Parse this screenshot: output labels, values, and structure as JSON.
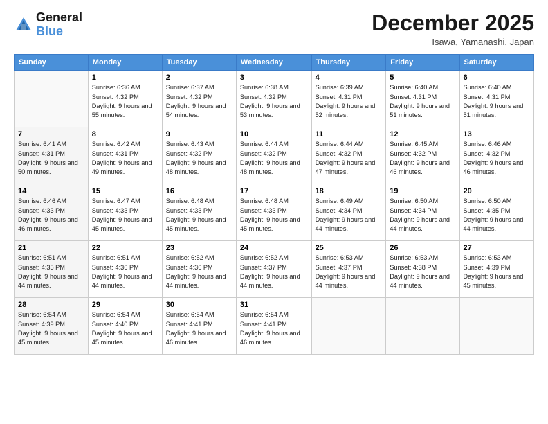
{
  "logo": {
    "line1": "General",
    "line2": "Blue"
  },
  "title": "December 2025",
  "location": "Isawa, Yamanashi, Japan",
  "days_header": [
    "Sunday",
    "Monday",
    "Tuesday",
    "Wednesday",
    "Thursday",
    "Friday",
    "Saturday"
  ],
  "weeks": [
    [
      {
        "day": "",
        "sunrise": "",
        "sunset": "",
        "daylight": ""
      },
      {
        "day": "1",
        "sunrise": "Sunrise: 6:36 AM",
        "sunset": "Sunset: 4:32 PM",
        "daylight": "Daylight: 9 hours and 55 minutes."
      },
      {
        "day": "2",
        "sunrise": "Sunrise: 6:37 AM",
        "sunset": "Sunset: 4:32 PM",
        "daylight": "Daylight: 9 hours and 54 minutes."
      },
      {
        "day": "3",
        "sunrise": "Sunrise: 6:38 AM",
        "sunset": "Sunset: 4:32 PM",
        "daylight": "Daylight: 9 hours and 53 minutes."
      },
      {
        "day": "4",
        "sunrise": "Sunrise: 6:39 AM",
        "sunset": "Sunset: 4:31 PM",
        "daylight": "Daylight: 9 hours and 52 minutes."
      },
      {
        "day": "5",
        "sunrise": "Sunrise: 6:40 AM",
        "sunset": "Sunset: 4:31 PM",
        "daylight": "Daylight: 9 hours and 51 minutes."
      },
      {
        "day": "6",
        "sunrise": "Sunrise: 6:40 AM",
        "sunset": "Sunset: 4:31 PM",
        "daylight": "Daylight: 9 hours and 51 minutes."
      }
    ],
    [
      {
        "day": "7",
        "sunrise": "Sunrise: 6:41 AM",
        "sunset": "Sunset: 4:31 PM",
        "daylight": "Daylight: 9 hours and 50 minutes."
      },
      {
        "day": "8",
        "sunrise": "Sunrise: 6:42 AM",
        "sunset": "Sunset: 4:31 PM",
        "daylight": "Daylight: 9 hours and 49 minutes."
      },
      {
        "day": "9",
        "sunrise": "Sunrise: 6:43 AM",
        "sunset": "Sunset: 4:32 PM",
        "daylight": "Daylight: 9 hours and 48 minutes."
      },
      {
        "day": "10",
        "sunrise": "Sunrise: 6:44 AM",
        "sunset": "Sunset: 4:32 PM",
        "daylight": "Daylight: 9 hours and 48 minutes."
      },
      {
        "day": "11",
        "sunrise": "Sunrise: 6:44 AM",
        "sunset": "Sunset: 4:32 PM",
        "daylight": "Daylight: 9 hours and 47 minutes."
      },
      {
        "day": "12",
        "sunrise": "Sunrise: 6:45 AM",
        "sunset": "Sunset: 4:32 PM",
        "daylight": "Daylight: 9 hours and 46 minutes."
      },
      {
        "day": "13",
        "sunrise": "Sunrise: 6:46 AM",
        "sunset": "Sunset: 4:32 PM",
        "daylight": "Daylight: 9 hours and 46 minutes."
      }
    ],
    [
      {
        "day": "14",
        "sunrise": "Sunrise: 6:46 AM",
        "sunset": "Sunset: 4:33 PM",
        "daylight": "Daylight: 9 hours and 46 minutes."
      },
      {
        "day": "15",
        "sunrise": "Sunrise: 6:47 AM",
        "sunset": "Sunset: 4:33 PM",
        "daylight": "Daylight: 9 hours and 45 minutes."
      },
      {
        "day": "16",
        "sunrise": "Sunrise: 6:48 AM",
        "sunset": "Sunset: 4:33 PM",
        "daylight": "Daylight: 9 hours and 45 minutes."
      },
      {
        "day": "17",
        "sunrise": "Sunrise: 6:48 AM",
        "sunset": "Sunset: 4:33 PM",
        "daylight": "Daylight: 9 hours and 45 minutes."
      },
      {
        "day": "18",
        "sunrise": "Sunrise: 6:49 AM",
        "sunset": "Sunset: 4:34 PM",
        "daylight": "Daylight: 9 hours and 44 minutes."
      },
      {
        "day": "19",
        "sunrise": "Sunrise: 6:50 AM",
        "sunset": "Sunset: 4:34 PM",
        "daylight": "Daylight: 9 hours and 44 minutes."
      },
      {
        "day": "20",
        "sunrise": "Sunrise: 6:50 AM",
        "sunset": "Sunset: 4:35 PM",
        "daylight": "Daylight: 9 hours and 44 minutes."
      }
    ],
    [
      {
        "day": "21",
        "sunrise": "Sunrise: 6:51 AM",
        "sunset": "Sunset: 4:35 PM",
        "daylight": "Daylight: 9 hours and 44 minutes."
      },
      {
        "day": "22",
        "sunrise": "Sunrise: 6:51 AM",
        "sunset": "Sunset: 4:36 PM",
        "daylight": "Daylight: 9 hours and 44 minutes."
      },
      {
        "day": "23",
        "sunrise": "Sunrise: 6:52 AM",
        "sunset": "Sunset: 4:36 PM",
        "daylight": "Daylight: 9 hours and 44 minutes."
      },
      {
        "day": "24",
        "sunrise": "Sunrise: 6:52 AM",
        "sunset": "Sunset: 4:37 PM",
        "daylight": "Daylight: 9 hours and 44 minutes."
      },
      {
        "day": "25",
        "sunrise": "Sunrise: 6:53 AM",
        "sunset": "Sunset: 4:37 PM",
        "daylight": "Daylight: 9 hours and 44 minutes."
      },
      {
        "day": "26",
        "sunrise": "Sunrise: 6:53 AM",
        "sunset": "Sunset: 4:38 PM",
        "daylight": "Daylight: 9 hours and 44 minutes."
      },
      {
        "day": "27",
        "sunrise": "Sunrise: 6:53 AM",
        "sunset": "Sunset: 4:39 PM",
        "daylight": "Daylight: 9 hours and 45 minutes."
      }
    ],
    [
      {
        "day": "28",
        "sunrise": "Sunrise: 6:54 AM",
        "sunset": "Sunset: 4:39 PM",
        "daylight": "Daylight: 9 hours and 45 minutes."
      },
      {
        "day": "29",
        "sunrise": "Sunrise: 6:54 AM",
        "sunset": "Sunset: 4:40 PM",
        "daylight": "Daylight: 9 hours and 45 minutes."
      },
      {
        "day": "30",
        "sunrise": "Sunrise: 6:54 AM",
        "sunset": "Sunset: 4:41 PM",
        "daylight": "Daylight: 9 hours and 46 minutes."
      },
      {
        "day": "31",
        "sunrise": "Sunrise: 6:54 AM",
        "sunset": "Sunset: 4:41 PM",
        "daylight": "Daylight: 9 hours and 46 minutes."
      },
      {
        "day": "",
        "sunrise": "",
        "sunset": "",
        "daylight": ""
      },
      {
        "day": "",
        "sunrise": "",
        "sunset": "",
        "daylight": ""
      },
      {
        "day": "",
        "sunrise": "",
        "sunset": "",
        "daylight": ""
      }
    ]
  ]
}
